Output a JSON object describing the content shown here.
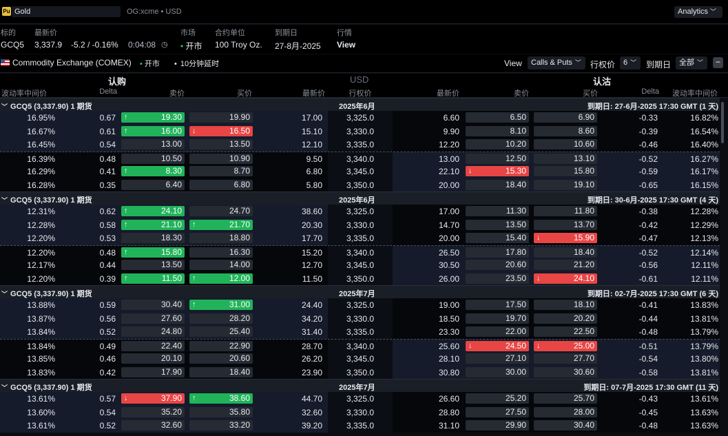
{
  "topbar": {
    "logo": "Pu",
    "symbol": "Gold",
    "source": "OG:xcme • USD",
    "analytics": "Analytics",
    "analytics_chevron": "chevron-down"
  },
  "info": {
    "labels": {
      "underlying": "标的",
      "last": "最新价",
      "market": "市场",
      "contract_unit": "合约单位",
      "expiry": "到期日",
      "quote": "行情"
    },
    "values": {
      "underlying": "GCQ5",
      "last": "3,337.9",
      "change": "-5.2 / -0.16%",
      "time": "0:04:08",
      "market_status": "开市",
      "contract_unit": "100 Troy Oz.",
      "expiry": "27-8月-2025",
      "quote_link": "View"
    }
  },
  "exchange": {
    "name": "Commodity Exchange (COMEX)",
    "status": "开市",
    "delay": "10分钟延时"
  },
  "controls": {
    "view_label": "View",
    "view_value": "Calls & Puts",
    "strikes_label": "行权价",
    "strikes_value": "6",
    "expiry_label": "到期日",
    "expiry_value": "全部",
    "collapse": "−"
  },
  "sides": {
    "calls": "认购",
    "currency": "USD",
    "puts": "认沽"
  },
  "columns": {
    "iv": "波动率中间价",
    "delta": "Delta",
    "ask": "卖价",
    "bid": "买价",
    "last": "最新价",
    "strike": "行权价"
  },
  "colors": {
    "up": "#21b35a",
    "down": "#e84545",
    "accent": "#3d8bff"
  },
  "groups": [
    {
      "title": "GCQ5 (3,337.90) 1 期货",
      "month": "2025年6月",
      "expiry": "到期日: 27-6月-2025 17:30 GMT (1 天)",
      "rows": [
        {
          "c_iv": "16.95%",
          "c_delta": "0.67",
          "c_ask": "19.30",
          "c_ask_t": "up",
          "c_bid": "19.90",
          "c_bid_t": "",
          "c_last": "17.00",
          "strike": "3,325.0",
          "p_last": "6.60",
          "p_ask": "6.50",
          "p_ask_t": "",
          "p_bid": "6.90",
          "p_bid_t": "",
          "p_delta": "-0.33",
          "p_iv": "16.82%"
        },
        {
          "c_iv": "16.67%",
          "c_delta": "0.61",
          "c_ask": "16.00",
          "c_ask_t": "up",
          "c_bid": "16.50",
          "c_bid_t": "down",
          "c_last": "15.10",
          "strike": "3,330.0",
          "p_last": "9.90",
          "p_ask": "8.10",
          "p_ask_t": "",
          "p_bid": "8.60",
          "p_bid_t": "",
          "p_delta": "-0.39",
          "p_iv": "16.54%"
        },
        {
          "c_iv": "16.45%",
          "c_delta": "0.54",
          "c_ask": "13.00",
          "c_ask_t": "",
          "c_bid": "13.50",
          "c_bid_t": "",
          "c_last": "12.10",
          "strike": "3,335.0",
          "p_last": "12.20",
          "p_ask": "10.20",
          "p_ask_t": "",
          "p_bid": "10.60",
          "p_bid_t": "",
          "p_delta": "-0.46",
          "p_iv": "16.40%"
        },
        {
          "c_iv": "16.39%",
          "c_delta": "0.48",
          "c_ask": "10.50",
          "c_ask_t": "",
          "c_bid": "10.90",
          "c_bid_t": "",
          "c_last": "9.50",
          "strike": "3,340.0",
          "p_last": "13.00",
          "p_ask": "12.50",
          "p_ask_t": "",
          "p_bid": "13.10",
          "p_bid_t": "",
          "p_delta": "-0.52",
          "p_iv": "16.27%"
        },
        {
          "c_iv": "16.29%",
          "c_delta": "0.41",
          "c_ask": "8.30",
          "c_ask_t": "up",
          "c_bid": "8.70",
          "c_bid_t": "",
          "c_last": "6.80",
          "strike": "3,345.0",
          "p_last": "22.10",
          "p_ask": "15.30",
          "p_ask_t": "down",
          "p_bid": "15.80",
          "p_bid_t": "",
          "p_delta": "-0.59",
          "p_iv": "16.17%"
        },
        {
          "c_iv": "16.28%",
          "c_delta": "0.35",
          "c_ask": "6.40",
          "c_ask_t": "",
          "c_bid": "6.80",
          "c_bid_t": "",
          "c_last": "5.80",
          "strike": "3,350.0",
          "p_last": "20.00",
          "p_ask": "18.40",
          "p_ask_t": "",
          "p_bid": "19.10",
          "p_bid_t": "",
          "p_delta": "-0.65",
          "p_iv": "16.15%"
        }
      ]
    },
    {
      "title": "GCQ5 (3,337.90) 1 期货",
      "month": "2025年6月",
      "expiry": "到期日: 30-6月-2025 17:30 GMT (4 天)",
      "rows": [
        {
          "c_iv": "12.31%",
          "c_delta": "0.62",
          "c_ask": "24.10",
          "c_ask_t": "up",
          "c_bid": "24.70",
          "c_bid_t": "",
          "c_last": "38.60",
          "strike": "3,325.0",
          "p_last": "17.00",
          "p_ask": "11.30",
          "p_ask_t": "",
          "p_bid": "11.80",
          "p_bid_t": "",
          "p_delta": "-0.38",
          "p_iv": "12.28%"
        },
        {
          "c_iv": "12.28%",
          "c_delta": "0.58",
          "c_ask": "21.10",
          "c_ask_t": "up",
          "c_bid": "21.70",
          "c_bid_t": "up",
          "c_last": "20.30",
          "strike": "3,330.0",
          "p_last": "14.70",
          "p_ask": "13.50",
          "p_ask_t": "",
          "p_bid": "13.70",
          "p_bid_t": "",
          "p_delta": "-0.42",
          "p_iv": "12.29%"
        },
        {
          "c_iv": "12.20%",
          "c_delta": "0.53",
          "c_ask": "18.30",
          "c_ask_t": "",
          "c_bid": "18.80",
          "c_bid_t": "",
          "c_last": "17.70",
          "strike": "3,335.0",
          "p_last": "20.00",
          "p_ask": "15.40",
          "p_ask_t": "",
          "p_bid": "15.90",
          "p_bid_t": "down",
          "p_delta": "-0.47",
          "p_iv": "12.13%"
        },
        {
          "c_iv": "12.20%",
          "c_delta": "0.48",
          "c_ask": "15.80",
          "c_ask_t": "up",
          "c_bid": "16.30",
          "c_bid_t": "",
          "c_last": "15.20",
          "strike": "3,340.0",
          "p_last": "26.50",
          "p_ask": "17.80",
          "p_ask_t": "",
          "p_bid": "18.40",
          "p_bid_t": "",
          "p_delta": "-0.52",
          "p_iv": "12.14%"
        },
        {
          "c_iv": "12.17%",
          "c_delta": "0.44",
          "c_ask": "13.50",
          "c_ask_t": "",
          "c_bid": "14.00",
          "c_bid_t": "",
          "c_last": "12.70",
          "strike": "3,345.0",
          "p_last": "30.50",
          "p_ask": "20.60",
          "p_ask_t": "",
          "p_bid": "21.20",
          "p_bid_t": "",
          "p_delta": "-0.56",
          "p_iv": "12.11%"
        },
        {
          "c_iv": "12.20%",
          "c_delta": "0.39",
          "c_ask": "11.50",
          "c_ask_t": "up",
          "c_bid": "12.00",
          "c_bid_t": "up",
          "c_last": "11.50",
          "strike": "3,350.0",
          "p_last": "26.00",
          "p_ask": "23.50",
          "p_ask_t": "",
          "p_bid": "24.10",
          "p_bid_t": "down",
          "p_delta": "-0.61",
          "p_iv": "12.11%"
        }
      ]
    },
    {
      "title": "GCQ5 (3,337.90) 1 期货",
      "month": "2025年7月",
      "expiry": "到期日: 02-7月-2025 17:30 GMT (6 天)",
      "rows": [
        {
          "c_iv": "13.88%",
          "c_delta": "0.59",
          "c_ask": "30.40",
          "c_ask_t": "",
          "c_bid": "31.00",
          "c_bid_t": "up",
          "c_last": "24.40",
          "strike": "3,325.0",
          "p_last": "19.00",
          "p_ask": "17.50",
          "p_ask_t": "",
          "p_bid": "18.10",
          "p_bid_t": "",
          "p_delta": "-0.41",
          "p_iv": "13.83%"
        },
        {
          "c_iv": "13.87%",
          "c_delta": "0.56",
          "c_ask": "27.60",
          "c_ask_t": "",
          "c_bid": "28.20",
          "c_bid_t": "",
          "c_last": "34.20",
          "strike": "3,330.0",
          "p_last": "18.50",
          "p_ask": "19.70",
          "p_ask_t": "",
          "p_bid": "20.20",
          "p_bid_t": "",
          "p_delta": "-0.44",
          "p_iv": "13.81%"
        },
        {
          "c_iv": "13.84%",
          "c_delta": "0.52",
          "c_ask": "24.80",
          "c_ask_t": "",
          "c_bid": "25.40",
          "c_bid_t": "",
          "c_last": "31.40",
          "strike": "3,335.0",
          "p_last": "23.30",
          "p_ask": "22.00",
          "p_ask_t": "",
          "p_bid": "22.50",
          "p_bid_t": "",
          "p_delta": "-0.48",
          "p_iv": "13.79%"
        },
        {
          "c_iv": "13.84%",
          "c_delta": "0.49",
          "c_ask": "22.40",
          "c_ask_t": "",
          "c_bid": "22.90",
          "c_bid_t": "",
          "c_last": "28.70",
          "strike": "3,340.0",
          "p_last": "25.60",
          "p_ask": "24.50",
          "p_ask_t": "down",
          "p_bid": "25.00",
          "p_bid_t": "down",
          "p_delta": "-0.51",
          "p_iv": "13.79%"
        },
        {
          "c_iv": "13.85%",
          "c_delta": "0.46",
          "c_ask": "20.10",
          "c_ask_t": "",
          "c_bid": "20.60",
          "c_bid_t": "",
          "c_last": "26.20",
          "strike": "3,345.0",
          "p_last": "28.10",
          "p_ask": "27.10",
          "p_ask_t": "",
          "p_bid": "27.70",
          "p_bid_t": "",
          "p_delta": "-0.54",
          "p_iv": "13.80%"
        },
        {
          "c_iv": "13.83%",
          "c_delta": "0.42",
          "c_ask": "17.90",
          "c_ask_t": "",
          "c_bid": "18.40",
          "c_bid_t": "",
          "c_last": "23.90",
          "strike": "3,350.0",
          "p_last": "30.80",
          "p_ask": "30.00",
          "p_ask_t": "",
          "p_bid": "30.60",
          "p_bid_t": "",
          "p_delta": "-0.58",
          "p_iv": "13.81%"
        }
      ]
    },
    {
      "title": "GCQ5 (3,337.90) 1 期货",
      "month": "2025年7月",
      "expiry": "到期日: 07-7月-2025 17:30 GMT (11 天)",
      "rows": [
        {
          "c_iv": "13.61%",
          "c_delta": "0.57",
          "c_ask": "37.90",
          "c_ask_t": "down",
          "c_bid": "38.60",
          "c_bid_t": "up",
          "c_last": "44.70",
          "strike": "3,325.0",
          "p_last": "26.60",
          "p_ask": "25.20",
          "p_ask_t": "",
          "p_bid": "25.70",
          "p_bid_t": "",
          "p_delta": "-0.43",
          "p_iv": "13.61%"
        },
        {
          "c_iv": "13.60%",
          "c_delta": "0.54",
          "c_ask": "35.20",
          "c_ask_t": "",
          "c_bid": "35.80",
          "c_bid_t": "",
          "c_last": "32.60",
          "strike": "3,330.0",
          "p_last": "28.80",
          "p_ask": "27.50",
          "p_ask_t": "",
          "p_bid": "28.00",
          "p_bid_t": "",
          "p_delta": "-0.45",
          "p_iv": "13.63%"
        },
        {
          "c_iv": "13.61%",
          "c_delta": "0.52",
          "c_ask": "32.60",
          "c_ask_t": "",
          "c_bid": "33.20",
          "c_bid_t": "",
          "c_last": "39.20",
          "strike": "3,335.0",
          "p_last": "31.10",
          "p_ask": "29.90",
          "p_ask_t": "",
          "p_bid": "30.40",
          "p_bid_t": "",
          "p_delta": "-0.48",
          "p_iv": "13.63%"
        }
      ]
    }
  ]
}
